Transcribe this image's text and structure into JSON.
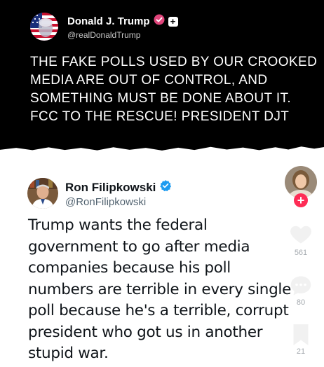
{
  "top_post": {
    "author_name": "Donald J. Trump",
    "author_handle": "@realDonaldTrump",
    "badge_plus": "+",
    "text": "THE FAKE POLLS USED BY OUR CROOKED MEDIA ARE OUT OF CONTROL, AND SOMETHING MUST BE DONE ABOUT IT. FCC TO THE RESCUE! PRESIDENT DJT"
  },
  "bottom_post": {
    "author_name": "Ron Filipkowski",
    "author_handle": "@RonFilipkowski",
    "text": "Trump wants the federal government to go after media companies because his poll numbers are terrible in every single poll because he's a terrible, corrupt president who got us in another stupid war."
  },
  "rail": {
    "follow_label": "+",
    "like_count": "561",
    "comment_count": "80",
    "save_count": "21"
  },
  "colors": {
    "verified_blue": "#1d9bf0",
    "follow_pink": "#fe2c55",
    "truth_badge": "#e0457b"
  }
}
